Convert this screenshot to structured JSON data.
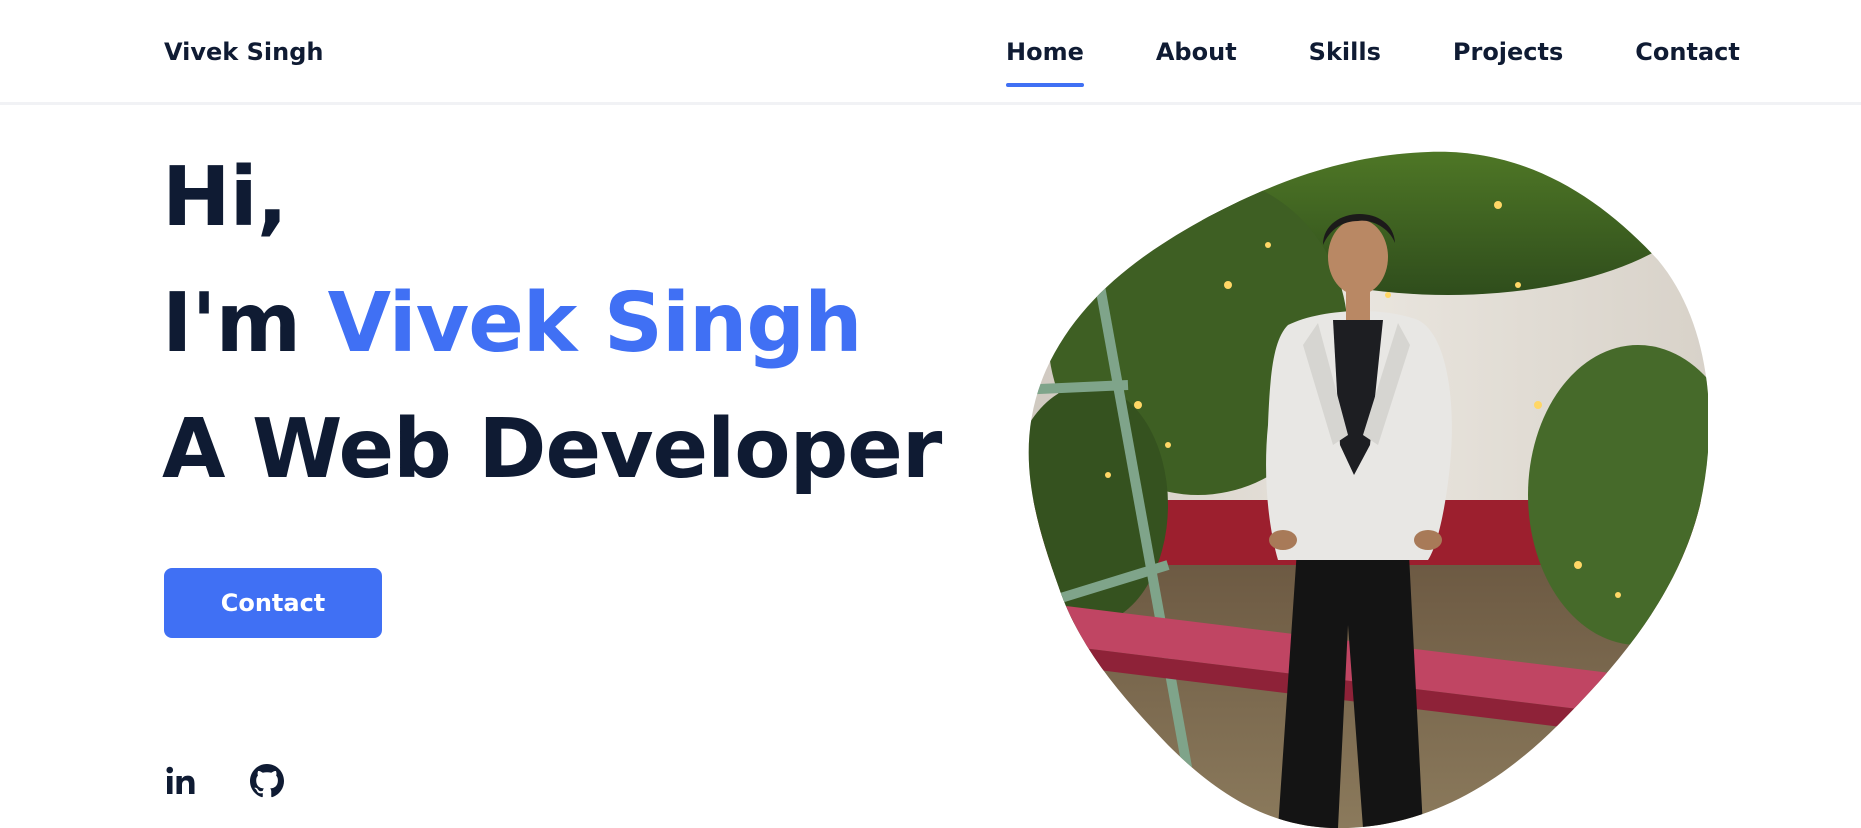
{
  "header": {
    "brand": "Vivek Singh",
    "nav": [
      {
        "label": "Home",
        "active": true
      },
      {
        "label": "About",
        "active": false
      },
      {
        "label": "Skills",
        "active": false
      },
      {
        "label": "Projects",
        "active": false
      },
      {
        "label": "Contact",
        "active": false
      }
    ]
  },
  "hero": {
    "greeting": "Hi,",
    "intro_prefix": "I'm ",
    "name": "Vivek Singh",
    "role": "A Web Developer",
    "button_label": "Contact"
  },
  "social": [
    {
      "icon": "linkedin-icon"
    },
    {
      "icon": "github-icon"
    }
  ],
  "colors": {
    "accent": "#4070f4",
    "text": "#0f1b33",
    "background": "#ffffff"
  }
}
